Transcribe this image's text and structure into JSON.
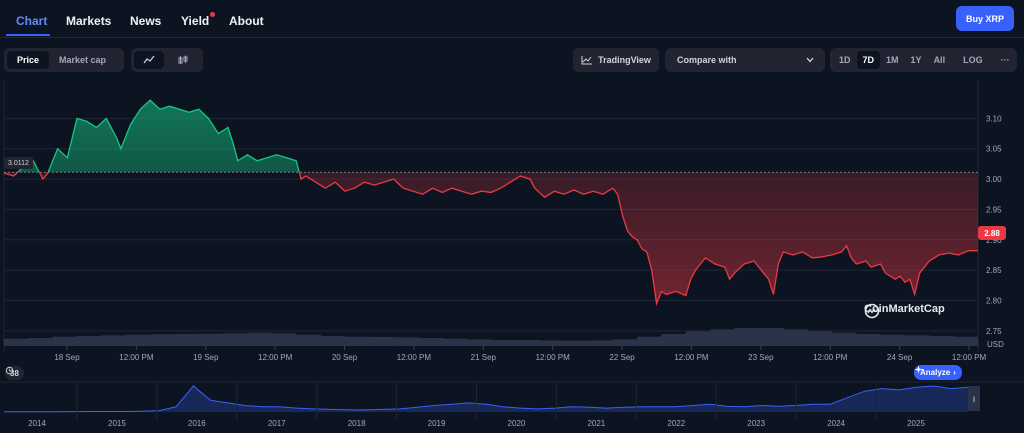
{
  "nav": {
    "tabs": [
      {
        "label": "Chart",
        "active": true
      },
      {
        "label": "Markets"
      },
      {
        "label": "News"
      },
      {
        "label": "Yield",
        "dot": true
      },
      {
        "label": "About"
      }
    ],
    "buy_label": "Buy XRP"
  },
  "toolbar": {
    "metric_toggle": [
      "Price",
      "Market cap"
    ],
    "selected_metric": "Price",
    "chart_type_icons": [
      "line-chart-icon",
      "candlestick-icon"
    ],
    "tradingview_label": "TradingView",
    "compare_placeholder": "Compare with",
    "ranges": [
      "1D",
      "7D",
      "1M",
      "1Y",
      "All"
    ],
    "selected_range": "7D",
    "log_label": "LOG",
    "more_label": "···"
  },
  "chart_data": {
    "type": "line",
    "currency_label": "USD",
    "reference_price": "3.0112",
    "last_price": "2.88",
    "y_ticks": [
      "3.10",
      "3.05",
      "3.00",
      "2.95",
      "2.90",
      "2.85",
      "2.80",
      "2.75"
    ],
    "ylim": [
      2.725,
      3.15
    ],
    "x_tick_labels": [
      "18 Sep",
      "12:00 PM",
      "19 Sep",
      "12:00 PM",
      "20 Sep",
      "12:00 PM",
      "21 Sep",
      "12:00 PM",
      "22 Sep",
      "12:00 PM",
      "23 Sep",
      "12:00 PM",
      "24 Sep",
      "12:00 PM"
    ],
    "price_series": [
      [
        0,
        3.01
      ],
      [
        0.01,
        3.005
      ],
      [
        0.02,
        3.02
      ],
      [
        0.03,
        3.03
      ],
      [
        0.035,
        3.015
      ],
      [
        0.04,
        3.0
      ],
      [
        0.045,
        3.01
      ],
      [
        0.055,
        3.05
      ],
      [
        0.065,
        3.035
      ],
      [
        0.075,
        3.1
      ],
      [
        0.085,
        3.095
      ],
      [
        0.095,
        3.085
      ],
      [
        0.105,
        3.1
      ],
      [
        0.115,
        3.07
      ],
      [
        0.12,
        3.05
      ],
      [
        0.13,
        3.09
      ],
      [
        0.14,
        3.115
      ],
      [
        0.15,
        3.13
      ],
      [
        0.16,
        3.115
      ],
      [
        0.17,
        3.12
      ],
      [
        0.18,
        3.115
      ],
      [
        0.19,
        3.11
      ],
      [
        0.2,
        3.115
      ],
      [
        0.21,
        3.1
      ],
      [
        0.22,
        3.075
      ],
      [
        0.23,
        3.085
      ],
      [
        0.235,
        3.06
      ],
      [
        0.24,
        3.03
      ],
      [
        0.25,
        3.04
      ],
      [
        0.26,
        3.03
      ],
      [
        0.27,
        3.035
      ],
      [
        0.28,
        3.04
      ],
      [
        0.29,
        3.035
      ],
      [
        0.3,
        3.03
      ],
      [
        0.305,
        3.0
      ],
      [
        0.31,
        3.005
      ],
      [
        0.315,
        3.0
      ],
      [
        0.32,
        2.995
      ],
      [
        0.33,
        2.985
      ],
      [
        0.34,
        2.995
      ],
      [
        0.35,
        2.98
      ],
      [
        0.36,
        2.985
      ],
      [
        0.37,
        2.995
      ],
      [
        0.38,
        2.99
      ],
      [
        0.39,
        2.995
      ],
      [
        0.4,
        3.0
      ],
      [
        0.41,
        2.985
      ],
      [
        0.42,
        2.98
      ],
      [
        0.43,
        2.975
      ],
      [
        0.44,
        2.985
      ],
      [
        0.45,
        2.978
      ],
      [
        0.46,
        2.985
      ],
      [
        0.47,
        2.98
      ],
      [
        0.48,
        2.975
      ],
      [
        0.49,
        2.98
      ],
      [
        0.5,
        2.978
      ],
      [
        0.51,
        2.985
      ],
      [
        0.52,
        2.995
      ],
      [
        0.53,
        3.005
      ],
      [
        0.54,
        3.0
      ],
      [
        0.545,
        2.985
      ],
      [
        0.555,
        2.97
      ],
      [
        0.565,
        2.98
      ],
      [
        0.575,
        2.975
      ],
      [
        0.585,
        2.982
      ],
      [
        0.595,
        2.975
      ],
      [
        0.605,
        2.98
      ],
      [
        0.615,
        2.975
      ],
      [
        0.625,
        2.985
      ],
      [
        0.63,
        2.975
      ],
      [
        0.635,
        2.94
      ],
      [
        0.64,
        2.915
      ],
      [
        0.645,
        2.905
      ],
      [
        0.65,
        2.9
      ],
      [
        0.655,
        2.885
      ],
      [
        0.66,
        2.88
      ],
      [
        0.665,
        2.85
      ],
      [
        0.67,
        2.795
      ],
      [
        0.675,
        2.815
      ],
      [
        0.68,
        2.81
      ],
      [
        0.69,
        2.815
      ],
      [
        0.7,
        2.808
      ],
      [
        0.705,
        2.835
      ],
      [
        0.71,
        2.85
      ],
      [
        0.72,
        2.87
      ],
      [
        0.73,
        2.86
      ],
      [
        0.74,
        2.855
      ],
      [
        0.745,
        2.835
      ],
      [
        0.75,
        2.845
      ],
      [
        0.76,
        2.86
      ],
      [
        0.77,
        2.865
      ],
      [
        0.78,
        2.845
      ],
      [
        0.785,
        2.835
      ],
      [
        0.79,
        2.81
      ],
      [
        0.795,
        2.86
      ],
      [
        0.8,
        2.88
      ],
      [
        0.81,
        2.875
      ],
      [
        0.82,
        2.88
      ],
      [
        0.83,
        2.87
      ],
      [
        0.84,
        2.872
      ],
      [
        0.85,
        2.875
      ],
      [
        0.86,
        2.88
      ],
      [
        0.865,
        2.89
      ],
      [
        0.87,
        2.87
      ],
      [
        0.875,
        2.86
      ],
      [
        0.885,
        2.865
      ],
      [
        0.89,
        2.855
      ],
      [
        0.9,
        2.86
      ],
      [
        0.905,
        2.845
      ],
      [
        0.915,
        2.835
      ],
      [
        0.92,
        2.84
      ],
      [
        0.925,
        2.83
      ],
      [
        0.93,
        2.835
      ],
      [
        0.935,
        2.81
      ],
      [
        0.94,
        2.845
      ],
      [
        0.95,
        2.865
      ],
      [
        0.96,
        2.875
      ],
      [
        0.97,
        2.878
      ],
      [
        0.98,
        2.875
      ],
      [
        0.99,
        2.882
      ],
      [
        1.0,
        2.882
      ]
    ],
    "volume_series": [
      0.55,
      0.6,
      0.7,
      0.75,
      0.8,
      0.85,
      0.88,
      0.9,
      0.92,
      0.95,
      1.0,
      0.95,
      0.85,
      0.75,
      0.7,
      0.68,
      0.65,
      0.6,
      0.55,
      0.5,
      0.45,
      0.45,
      0.42,
      0.4,
      0.42,
      0.5,
      0.7,
      0.9,
      1.1,
      1.25,
      1.35,
      1.35,
      1.25,
      1.1,
      1.0,
      0.9,
      0.85,
      0.8,
      0.75,
      0.7
    ],
    "navigator": {
      "years": [
        "2014",
        "2015",
        "2016",
        "2017",
        "2018",
        "2019",
        "2020",
        "2021",
        "2022",
        "2023",
        "2024",
        "2025"
      ],
      "series": [
        0.01,
        0.01,
        0.01,
        0.01,
        0.015,
        0.02,
        0.02,
        0.02,
        0.03,
        0.05,
        0.2,
        1.0,
        0.45,
        0.35,
        0.25,
        0.2,
        0.2,
        0.15,
        0.12,
        0.1,
        0.08,
        0.08,
        0.1,
        0.12,
        0.18,
        0.25,
        0.3,
        0.35,
        0.3,
        0.2,
        0.15,
        0.12,
        0.15,
        0.2,
        0.18,
        0.15,
        0.18,
        0.2,
        0.2,
        0.2,
        0.25,
        0.3,
        0.22,
        0.2,
        0.25,
        0.22,
        0.25,
        0.3,
        0.3,
        0.55,
        0.8,
        0.9,
        0.85,
        0.95,
        1.0,
        0.9,
        0.95
      ]
    },
    "events_count": "38",
    "analyze_label": "Analyze",
    "watermark": "CoinMarketCap",
    "colors": {
      "up": "#16c784",
      "down": "#ea3943",
      "volume": "#2a3347",
      "navigator": "#3861fb",
      "grid": "#1e2534"
    }
  }
}
